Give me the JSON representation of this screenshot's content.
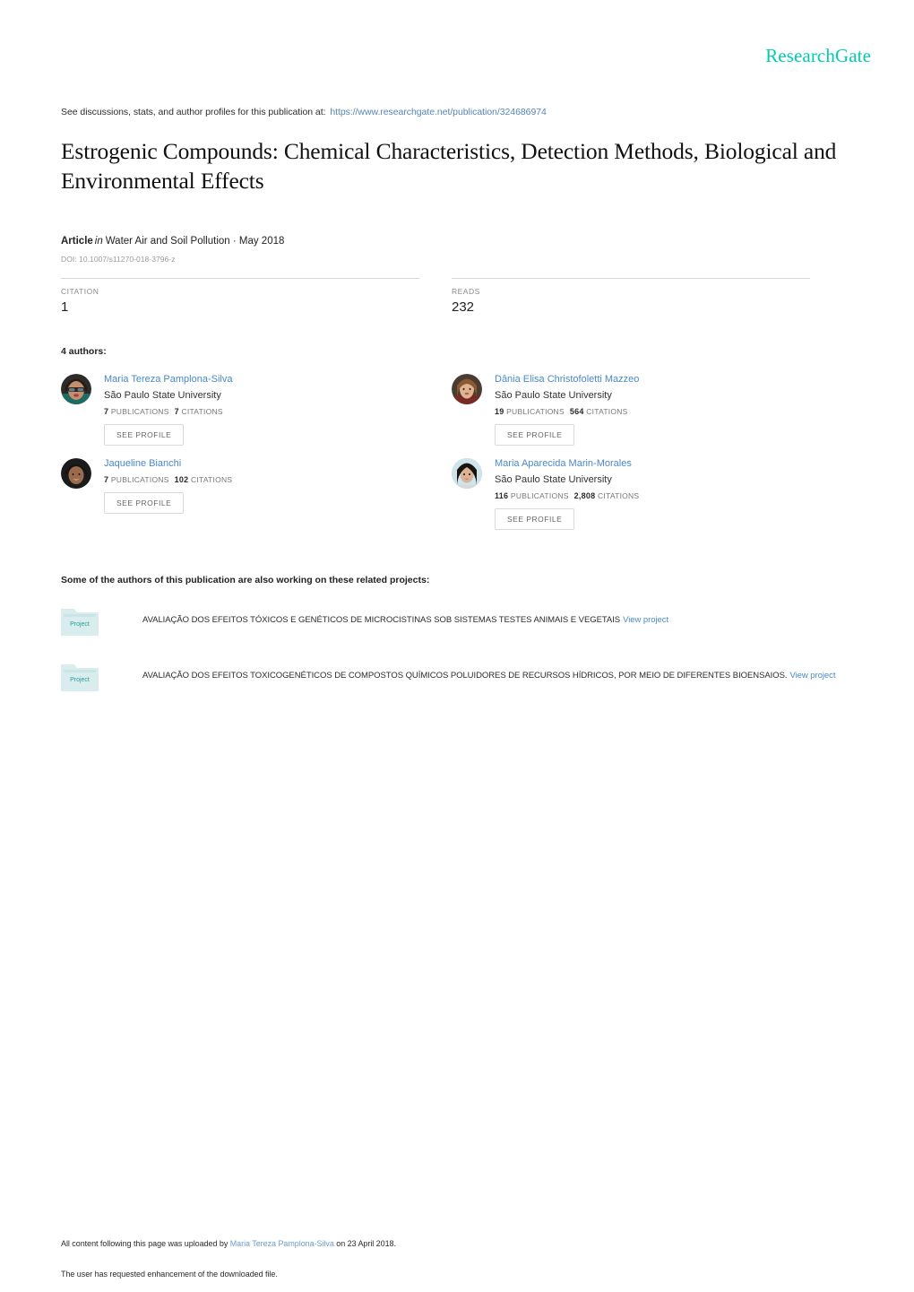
{
  "brand": {
    "name": "ResearchGate",
    "color": "#00ccb2"
  },
  "header": {
    "discussion_prefix": "See discussions, stats, and author profiles for this publication at:",
    "publication_url": "https://www.researchgate.net/publication/324686974"
  },
  "publication": {
    "title": "Estrogenic Compounds: Chemical Characteristics, Detection Methods, Biological and Environmental Effects",
    "type": "Article",
    "in_word": "in",
    "journal": "Water Air and Soil Pollution · May 2018",
    "doi": "DOI: 10.1007/s11270-018-3796-z"
  },
  "stats": {
    "citation_label": "CITATION",
    "citation_value": "1",
    "reads_label": "READS",
    "reads_value": "232"
  },
  "authors": {
    "heading": "4 authors:",
    "see_profile_label": "SEE PROFILE",
    "publications_label": "PUBLICATIONS",
    "citations_label": "CITATIONS",
    "list": [
      {
        "name": "Maria Tereza Pamplona-Silva",
        "institution": "São Paulo State University",
        "publications": "7",
        "citations": "7"
      },
      {
        "name": "Dânia Elisa Christofoletti Mazzeo",
        "institution": "São Paulo State University",
        "publications": "19",
        "citations": "564"
      },
      {
        "name": "Jaqueline Bianchi",
        "institution": "",
        "publications": "7",
        "citations": "102"
      },
      {
        "name": "Maria Aparecida Marin-Morales",
        "institution": "São Paulo State University",
        "publications": "116",
        "citations": "2,808"
      }
    ]
  },
  "projects": {
    "heading": "Some of the authors of this publication are also working on these related projects:",
    "folder_label": "Project",
    "view_label": "View project",
    "list": [
      {
        "title": "AVALIAÇÃO DOS EFEITOS TÓXICOS E GENÉTICOS DE MICROCISTINAS SOB SISTEMAS TESTES ANIMAIS E VEGETAIS"
      },
      {
        "title": "AVALIAÇÃO DOS EFEITOS TOXICOGENÉTICOS DE COMPOSTOS QUÍMICOS POLUIDORES DE RECURSOS HÍDRICOS, POR MEIO DE DIFERENTES BIOENSAIOS."
      }
    ]
  },
  "footer": {
    "uploaded_prefix": "All content following this page was uploaded by",
    "uploaded_by": "Maria Tereza Pamplona-Silva",
    "uploaded_suffix": "on 23 April 2018.",
    "enhancement_note": "The user has requested enhancement of the downloaded file."
  }
}
